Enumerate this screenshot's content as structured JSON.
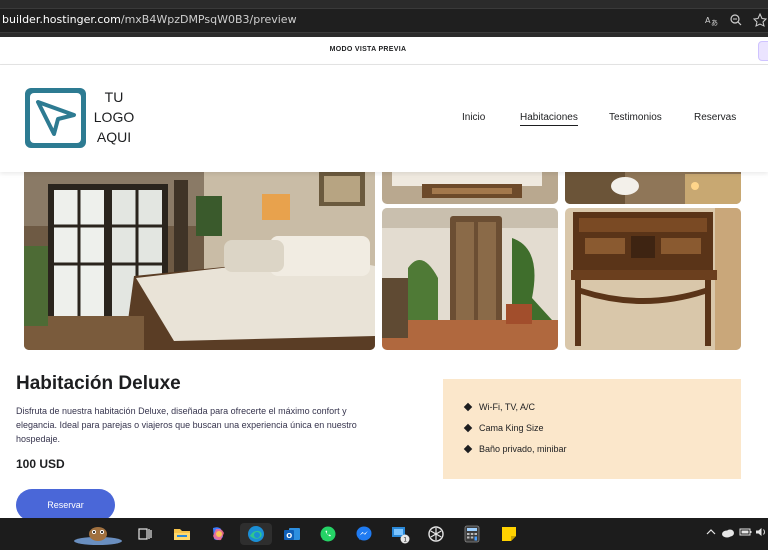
{
  "browser": {
    "url_host": "builder.hostinger.com",
    "url_path": "/mxB4WpzDMPsqW0B3/preview",
    "icons": [
      "translate-icon",
      "zoom-icon",
      "favorite-icon"
    ]
  },
  "preview": {
    "label": "MODO VISTA PREVIA"
  },
  "header": {
    "logo_lines": [
      "TU",
      "LOGO",
      "AQUI"
    ],
    "nav": [
      {
        "label": "Inicio",
        "active": false
      },
      {
        "label": "Habitaciones",
        "active": true
      },
      {
        "label": "Testimonios",
        "active": false
      },
      {
        "label": "Reservas",
        "active": false
      }
    ]
  },
  "room": {
    "title": "Habitación Deluxe",
    "description": "Disfruta de nuestra habitación Deluxe, diseñada para ofrecerte el máximo confort y elegancia. Ideal para parejas o viajeros que buscan una experiencia única en nuestro hospedaje.",
    "price": "100 USD",
    "button_label": "Reservar",
    "amenities": [
      "Wi-Fi, TV, A/C",
      "Cama King Size",
      "Baño privado, minibar"
    ]
  },
  "taskbar": {
    "badge_count": "1",
    "apps": [
      "widgets-icon",
      "task-view-icon",
      "file-explorer-icon",
      "copilot-icon",
      "edge-icon",
      "outlook-icon",
      "whatsapp-icon",
      "messenger-icon",
      "remote-desktop-icon",
      "chatgpt-icon",
      "calculator-icon",
      "sticky-notes-icon"
    ]
  },
  "colors": {
    "accent": "#4a67d8",
    "amenities_bg": "#fbe7cb",
    "logo": "#2d7b92"
  }
}
